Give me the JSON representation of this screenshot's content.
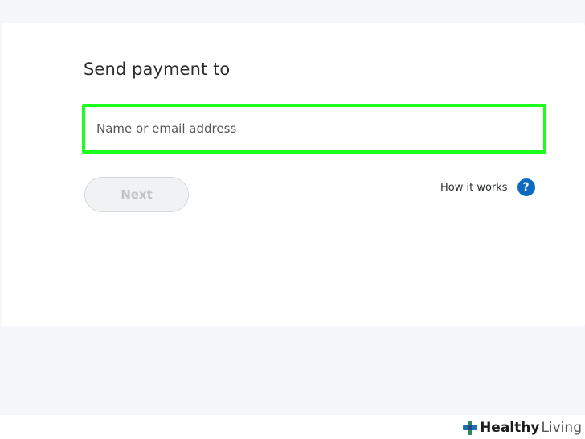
{
  "form": {
    "title": "Send payment to",
    "recipient_placeholder": "Name or email address",
    "next_label": "Next",
    "help_link_label": "How it works",
    "help_icon": "question-circle-icon",
    "help_icon_glyph": "?"
  },
  "colors": {
    "highlight": "#1cff1c",
    "accent": "#0c6bbf"
  },
  "watermark": {
    "brand_bold": "Healthy",
    "brand_light": "Living"
  }
}
